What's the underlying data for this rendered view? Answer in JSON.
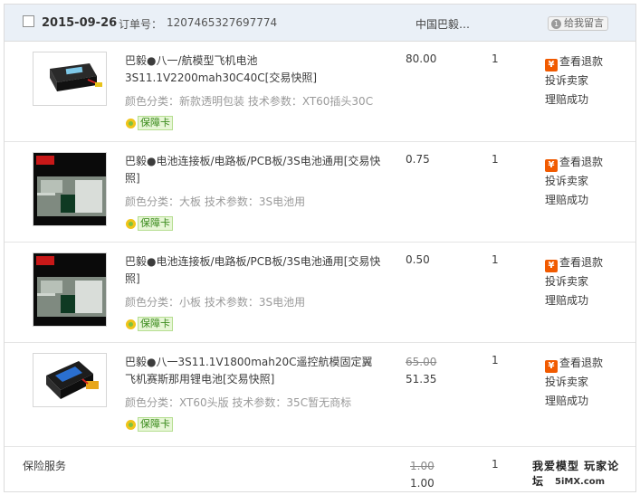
{
  "header": {
    "date": "2015-09-26",
    "order_label": "订单号：",
    "order_no": "1207465327697774",
    "shop": "中国巴毅…",
    "message_button": "给我留言",
    "message_badge": "1"
  },
  "items": [
    {
      "title": "巴毅●八一/航模型飞机电池3S11.1V2200mah30C40C[交易快照]",
      "attrs": "颜色分类：新款透明包装  技术参数：XT60插头30C",
      "card": "保障卡",
      "price": "80.00",
      "old_price": "",
      "qty": "1",
      "thumb_icon": "lipo-battery-photo"
    },
    {
      "title": "巴毅●电池连接板/电路板/PCB板/3S电池通用[交易快照]",
      "attrs": "颜色分类：大板  技术参数：3S电池用",
      "card": "保障卡",
      "price": "0.75",
      "old_price": "",
      "qty": "1",
      "thumb_icon": "pcb-board-photo"
    },
    {
      "title": "巴毅●电池连接板/电路板/PCB板/3S电池通用[交易快照]",
      "attrs": "颜色分类：小板  技术参数：3S电池用",
      "card": "保障卡",
      "price": "0.50",
      "old_price": "",
      "qty": "1",
      "thumb_icon": "pcb-board-photo"
    },
    {
      "title": "巴毅●八一3S11.1V1800mah20C遥控航模固定翼飞机赛斯那用锂电池[交易快照]",
      "attrs": "颜色分类：XT60头版  技术参数：35C暂无商标",
      "card": "保障卡",
      "price": "51.35",
      "old_price": "65.00",
      "qty": "1",
      "thumb_icon": "lipo-battery-photo"
    }
  ],
  "actions": {
    "refund": "查看退款",
    "complain": "投诉卖家",
    "claim": "理赔成功",
    "refund_icon": "yen-icon"
  },
  "service": {
    "label": "保险服务",
    "old_price": "1.00",
    "price": "1.00",
    "qty": "1"
  },
  "watermark": {
    "line1": "我爱模型 玩家论坛",
    "line2": "5iMX.com"
  },
  "colors": {
    "header_bg": "#eaf0f7",
    "badge_green": "#3a8a1c",
    "refund_orange": "#f15a00"
  }
}
